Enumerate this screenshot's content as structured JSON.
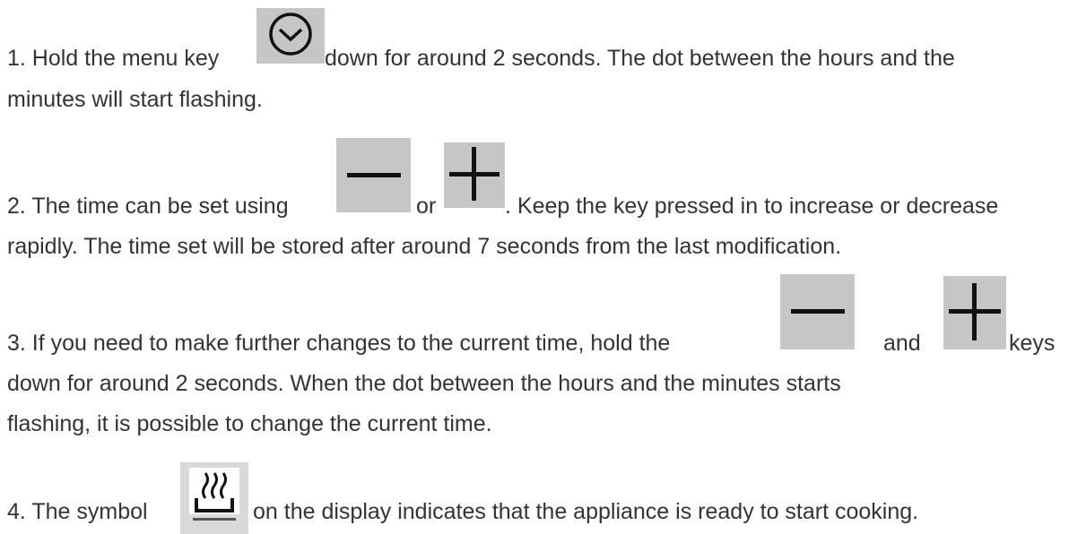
{
  "steps": [
    {
      "line1_before_icon": "1. Hold the menu key",
      "line1_after_icon": " down for around 2 seconds. The dot between the hours and the",
      "line2": "minutes will start flashing.",
      "icons": [
        "clock-icon"
      ]
    },
    {
      "line1_before_icon": "2. The time can be set using",
      "line1_between_icons": "or",
      "line1_after_icon": ". Keep the key pressed in to increase or decrease",
      "line2": "rapidly. The time set will be stored after around 7 seconds from the last modification.",
      "icons": [
        "minus-icon",
        "plus-icon"
      ]
    },
    {
      "line1_before_icon": "3. If you need to make further changes to the current time, hold the",
      "line1_between_icons": "and",
      "line1_after_icon": "keys",
      "line2": "down for around 2 seconds. When the dot between the hours and the minutes starts",
      "line3": "flashing, it is possible to change the current time.",
      "icons": [
        "minus-icon",
        "plus-icon"
      ]
    },
    {
      "line1_before_icon": "4. The symbol",
      "line1_after_icon": "on the display indicates that the appliance is ready to start cooking.",
      "icons": [
        "steam-symbol-icon"
      ]
    }
  ],
  "colors": {
    "text": "#333333",
    "icon_background": "#c6c6c6",
    "icon_glyph": "#111111"
  }
}
